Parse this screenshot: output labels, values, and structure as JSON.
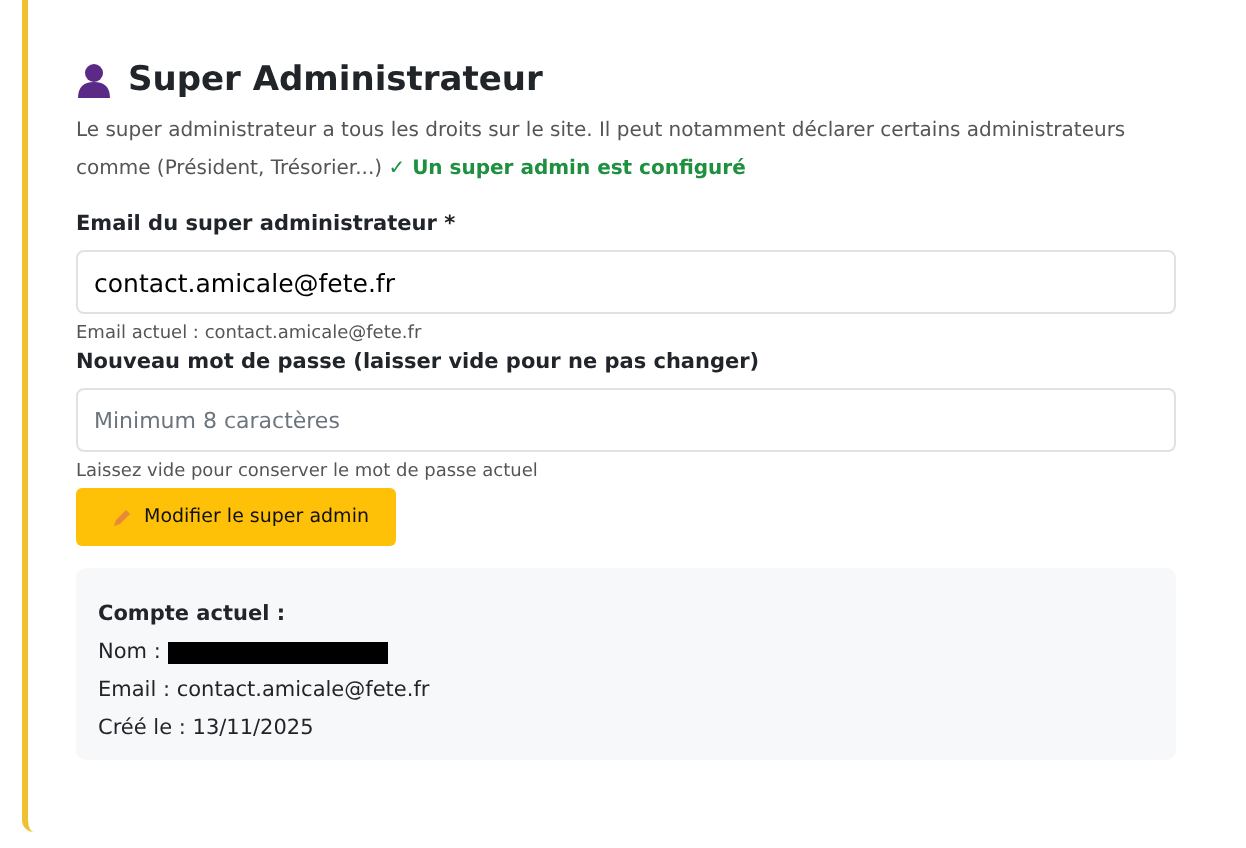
{
  "section": {
    "title": "Super Administrateur",
    "description": "Le super administrateur a tous les droits sur le site. Il peut notamment déclarer certains administrateurs comme (Président, Trésorier...)",
    "status": "✓ Un super admin est configuré"
  },
  "fields": [
    {
      "label": "Email du super administrateur *",
      "value": "contact.amicale@fete.fr",
      "hint": "Email actuel : contact.amicale@fete.fr"
    },
    {
      "label": "Nouveau mot de passe (laisser vide pour ne pas changer)",
      "placeholder": "Minimum 8 caractères",
      "hint": "Laissez vide pour conserver le mot de passe actuel"
    }
  ],
  "button": {
    "label": "Modifier le super admin"
  },
  "account": {
    "title": "Compte actuel :",
    "name_label": "Nom :",
    "email": "Email : contact.amicale@fete.fr",
    "created": "Créé le : 13/11/2025"
  }
}
